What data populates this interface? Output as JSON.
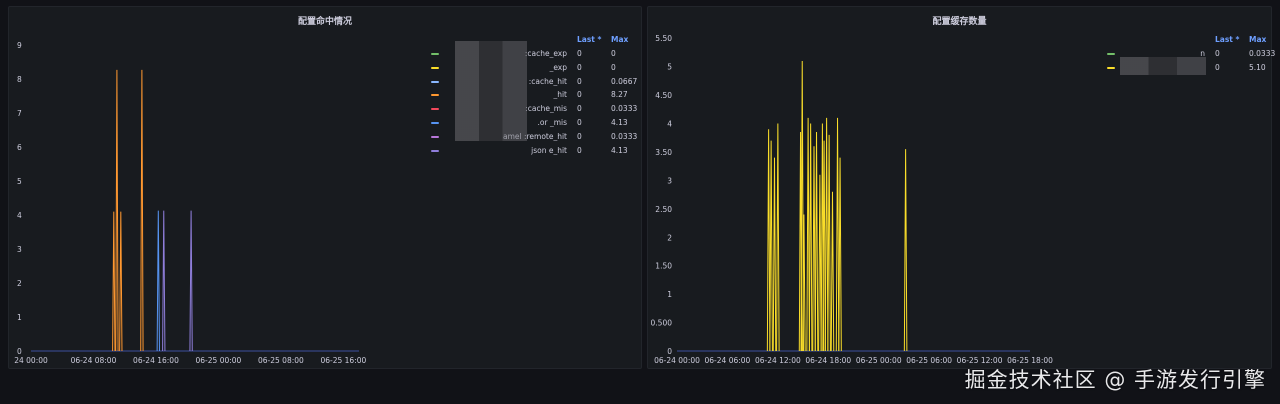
{
  "watermark": "掘金技术社区 @ 手游发行引擎",
  "colors": {
    "background": "#111217",
    "panel": "#181b1f",
    "grid": "#22252b",
    "text": "#ccccdc",
    "header": "#6e9fff",
    "axis_line": "#3b4f9e"
  },
  "panels": [
    {
      "title": "配置命中情况",
      "legend_headers": {
        "last": "Last *",
        "max": "Max"
      },
      "legend": [
        {
          "name": ":cache_exp",
          "color": "#73bf69",
          "last": "0",
          "max": "0"
        },
        {
          "name": "_exp",
          "color": "#fade2a",
          "last": "0",
          "max": "0"
        },
        {
          "name": ":cache_hit",
          "color": "#8ab8ff",
          "last": "0",
          "max": "0.0667"
        },
        {
          "name": "_hit",
          "color": "#ff9830",
          "last": "0",
          "max": "8.27"
        },
        {
          "name": ":cache_mis",
          "color": "#f2495c",
          "last": "0",
          "max": "0.0333"
        },
        {
          "name": ".or    _mis",
          "color": "#5794f2",
          "last": "0",
          "max": "4.13"
        },
        {
          "name": "amel    :remote_hit",
          "color": "#b877d9",
          "last": "0",
          "max": "0.0333"
        },
        {
          "name": "json    e_hit",
          "color": "#8f7edb",
          "last": "0",
          "max": "4.13"
        }
      ]
    },
    {
      "title": "配置缓存数量",
      "legend_headers": {
        "last": "Last *",
        "max": "Max"
      },
      "legend": [
        {
          "name": "n",
          "color": "#73bf69",
          "last": "0",
          "max": "0.0333"
        },
        {
          "name": "",
          "color": "#fade2a",
          "last": "0",
          "max": "5.10"
        }
      ]
    }
  ],
  "chart_data": [
    {
      "type": "line",
      "title": "配置命中情况",
      "xlabel": "",
      "ylabel": "",
      "x_range": [
        "06-24 00:00",
        "06-25 18:00"
      ],
      "x_ticks": [
        "24 00:00",
        "06-24 08:00",
        "06-24 16:00",
        "06-25 00:00",
        "06-25 08:00",
        "06-25 16:00"
      ],
      "x_tick_hours": [
        0,
        8,
        16,
        24,
        32,
        40
      ],
      "ylim": [
        0,
        9
      ],
      "y_ticks": [
        "0",
        "1",
        "2",
        "3",
        "4",
        "5",
        "6",
        "7",
        "8",
        "9"
      ],
      "grid": false,
      "legend_position": "top-right",
      "series": [
        {
          "name": "_hit",
          "color": "#ff9830",
          "spikes": [
            [
              10.6,
              4.1
            ],
            [
              11.0,
              8.27
            ],
            [
              11.5,
              4.1
            ],
            [
              14.2,
              8.27
            ]
          ]
        },
        {
          "name": ".or    _mis",
          "color": "#5794f2",
          "spikes": [
            [
              16.3,
              4.13
            ]
          ]
        },
        {
          "name": "json    e_hit",
          "color": "#8f7edb",
          "spikes": [
            [
              17.0,
              4.13
            ],
            [
              20.5,
              4.13
            ]
          ]
        }
      ]
    },
    {
      "type": "line",
      "title": "配置缓存数量",
      "xlabel": "",
      "ylabel": "",
      "x_range": [
        "06-24 00:00",
        "06-25 18:00"
      ],
      "x_ticks": [
        "06-24 00:00",
        "06-24 06:00",
        "06-24 12:00",
        "06-24 18:00",
        "06-25 00:00",
        "06-25 06:00",
        "06-25 12:00",
        "06-25 18:00"
      ],
      "x_tick_hours": [
        0,
        6,
        12,
        18,
        24,
        30,
        36,
        42
      ],
      "ylim": [
        0,
        5.75
      ],
      "y_ticks": [
        "0",
        "0.500",
        "1",
        "1.50",
        "2",
        "2.50",
        "3",
        "3.50",
        "4",
        "4.50",
        "5",
        "5.50"
      ],
      "grid": false,
      "legend_position": "top-right",
      "series": [
        {
          "name": "",
          "color": "#fade2a",
          "spikes": [
            [
              10.9,
              3.9
            ],
            [
              11.2,
              3.7
            ],
            [
              11.6,
              3.4
            ],
            [
              12.0,
              4.0
            ],
            [
              14.7,
              3.85
            ],
            [
              14.9,
              5.1
            ],
            [
              15.1,
              2.4
            ],
            [
              15.6,
              4.1
            ],
            [
              15.9,
              4.0
            ],
            [
              16.3,
              3.6
            ],
            [
              16.6,
              3.85
            ],
            [
              17.0,
              3.1
            ],
            [
              17.3,
              4.0
            ],
            [
              17.5,
              3.7
            ],
            [
              17.8,
              4.1
            ],
            [
              18.1,
              3.8
            ],
            [
              18.5,
              2.8
            ],
            [
              19.1,
              4.1
            ],
            [
              19.4,
              3.4
            ],
            [
              27.2,
              3.55
            ]
          ]
        }
      ]
    }
  ]
}
